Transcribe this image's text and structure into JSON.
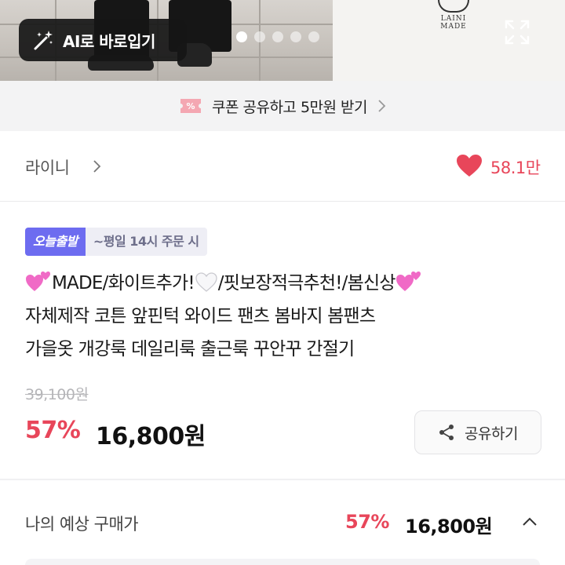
{
  "hero": {
    "ai_button_label": "AI로 바로입기",
    "carousel_dots": 6,
    "carousel_active_index": 0,
    "brand_logo_text": "LAINI MADE"
  },
  "coupon": {
    "text": "쿠폰 공유하고 5만원 받기"
  },
  "shop": {
    "name": "라이니",
    "like_count": "58.1만"
  },
  "badge": {
    "label": "오늘출발",
    "detail": "~평일 14시 주문 시"
  },
  "product": {
    "title_line1_a": "MADE/화이트추가!",
    "title_line1_b": "/핏보장적극추천!/봄신상",
    "title_line2": "자체제작 코튼 앞핀턱 와이드 팬츠 봄바지 봄팬츠",
    "title_line3": "가을옷 개강룩 데일리룩 출근룩 꾸안꾸 간절기",
    "original_price": "39,100원",
    "discount": "57%",
    "price": "16,800원",
    "share_label": "공유하기"
  },
  "estimate": {
    "label": "나의 예상 구매가",
    "discount": "57%",
    "price": "16,800원"
  },
  "colors": {
    "accent_red": "#e8465a",
    "badge_purple": "#6d6cf0"
  }
}
